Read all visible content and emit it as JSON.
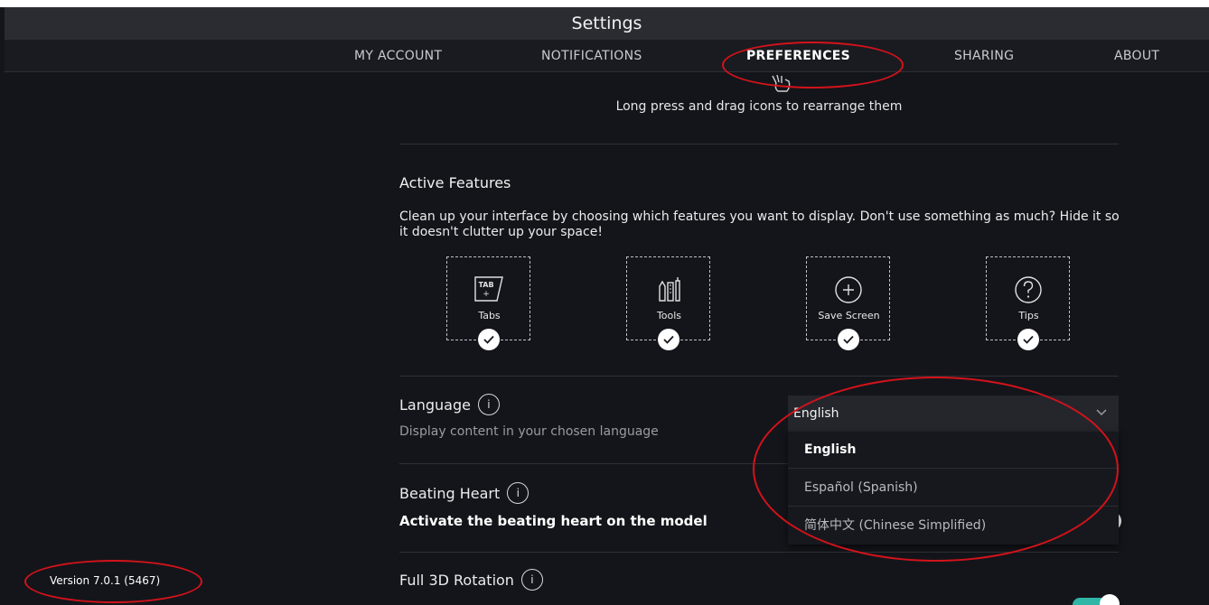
{
  "window": {
    "title": "Settings"
  },
  "tabs": [
    {
      "label": "MY ACCOUNT"
    },
    {
      "label": "NOTIFICATIONS"
    },
    {
      "label": "PREFERENCES"
    },
    {
      "label": "SHARING"
    },
    {
      "label": "ABOUT"
    }
  ],
  "active_tab": "PREFERENCES",
  "hint": "Long press and drag icons to rearrange them",
  "active_features": {
    "title": "Active Features",
    "description": "Clean up your interface by choosing which features you want to display. Don't use something as much? Hide it so it doesn't clutter up your space!",
    "items": [
      {
        "label": "Tabs",
        "icon": "tab-icon",
        "checked": true
      },
      {
        "label": "Tools",
        "icon": "tools-icon",
        "checked": true
      },
      {
        "label": "Save Screen",
        "icon": "plus-circle-icon",
        "checked": true
      },
      {
        "label": "Tips",
        "icon": "question-circle-icon",
        "checked": true
      }
    ]
  },
  "language": {
    "title": "Language",
    "info_glyph": "i",
    "subtitle": "Display content in your chosen language",
    "selected": "English",
    "options": [
      "English",
      "Español (Spanish)",
      "简体中文 (Chinese Simplified)"
    ]
  },
  "beating_heart": {
    "title": "Beating Heart",
    "info_glyph": "i",
    "subtitle": "Activate the beating heart on the model"
  },
  "full_rotation": {
    "title": "Full 3D Rotation",
    "info_glyph": "i"
  },
  "version": "Version 7.0.1 (5467)",
  "colors": {
    "background": "#14151a",
    "accent": "#2fb6a6",
    "annotation": "#d4121b"
  }
}
